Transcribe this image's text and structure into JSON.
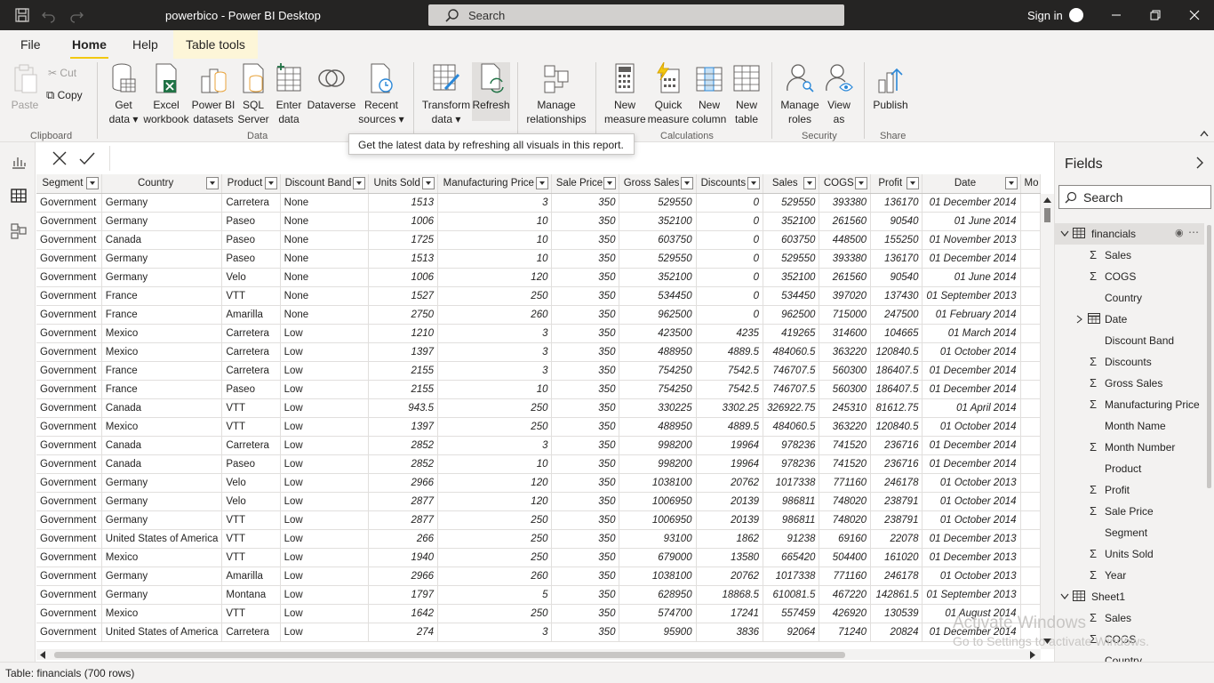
{
  "titlebar": {
    "title": "powerbico - Power BI Desktop",
    "search_placeholder": "Search",
    "sign_in": "Sign in"
  },
  "ribbon_tabs": [
    "File",
    "Home",
    "Help",
    "Table tools"
  ],
  "ribbon": {
    "clipboard": {
      "paste": "Paste",
      "cut": "Cut",
      "copy": "Copy",
      "label": "Clipboard"
    },
    "data": {
      "get_data": [
        "Get",
        "data"
      ],
      "excel": [
        "Excel",
        "workbook"
      ],
      "pbi_datasets": [
        "Power BI",
        "datasets"
      ],
      "sql": [
        "SQL",
        "Server"
      ],
      "enter_data": [
        "Enter",
        "data"
      ],
      "dataverse": [
        "Dataverse",
        ""
      ],
      "recent": [
        "Recent",
        "sources"
      ],
      "label": "Data"
    },
    "queries": {
      "transform": [
        "Transform",
        "data"
      ],
      "refresh": [
        "Refresh",
        ""
      ]
    },
    "relationships": {
      "manage": [
        "Manage",
        "relationships"
      ]
    },
    "calculations": {
      "new_measure": [
        "New",
        "measure"
      ],
      "quick_measure": [
        "Quick",
        "measure"
      ],
      "new_column": [
        "New",
        "column"
      ],
      "new_table": [
        "New",
        "table"
      ],
      "label": "Calculations"
    },
    "security": {
      "manage_roles": [
        "Manage",
        "roles"
      ],
      "view_as": [
        "View",
        "as"
      ],
      "label": "Security"
    },
    "share": {
      "publish": "Publish",
      "label": "Share"
    }
  },
  "tooltip": "Get the latest data by refreshing all visuals in this report.",
  "grid": {
    "columns": [
      "Segment",
      "Country",
      "Product",
      "Discount Band",
      "Units Sold",
      "Manufacturing Price",
      "Sale Price",
      "Gross Sales",
      "Discounts",
      "Sales",
      "COGS",
      "Profit",
      "Date",
      "Mo"
    ],
    "rows": [
      [
        "Government",
        "Germany",
        "Carretera",
        "None",
        "1513",
        "3",
        "350",
        "529550",
        "0",
        "529550",
        "393380",
        "136170",
        "01 December 2014"
      ],
      [
        "Government",
        "Germany",
        "Paseo",
        "None",
        "1006",
        "10",
        "350",
        "352100",
        "0",
        "352100",
        "261560",
        "90540",
        "01 June 2014"
      ],
      [
        "Government",
        "Canada",
        "Paseo",
        "None",
        "1725",
        "10",
        "350",
        "603750",
        "0",
        "603750",
        "448500",
        "155250",
        "01 November 2013"
      ],
      [
        "Government",
        "Germany",
        "Paseo",
        "None",
        "1513",
        "10",
        "350",
        "529550",
        "0",
        "529550",
        "393380",
        "136170",
        "01 December 2014"
      ],
      [
        "Government",
        "Germany",
        "Velo",
        "None",
        "1006",
        "120",
        "350",
        "352100",
        "0",
        "352100",
        "261560",
        "90540",
        "01 June 2014"
      ],
      [
        "Government",
        "France",
        "VTT",
        "None",
        "1527",
        "250",
        "350",
        "534450",
        "0",
        "534450",
        "397020",
        "137430",
        "01 September 2013"
      ],
      [
        "Government",
        "France",
        "Amarilla",
        "None",
        "2750",
        "260",
        "350",
        "962500",
        "0",
        "962500",
        "715000",
        "247500",
        "01 February 2014"
      ],
      [
        "Government",
        "Mexico",
        "Carretera",
        "Low",
        "1210",
        "3",
        "350",
        "423500",
        "4235",
        "419265",
        "314600",
        "104665",
        "01 March 2014"
      ],
      [
        "Government",
        "Mexico",
        "Carretera",
        "Low",
        "1397",
        "3",
        "350",
        "488950",
        "4889.5",
        "484060.5",
        "363220",
        "120840.5",
        "01 October 2014"
      ],
      [
        "Government",
        "France",
        "Carretera",
        "Low",
        "2155",
        "3",
        "350",
        "754250",
        "7542.5",
        "746707.5",
        "560300",
        "186407.5",
        "01 December 2014"
      ],
      [
        "Government",
        "France",
        "Paseo",
        "Low",
        "2155",
        "10",
        "350",
        "754250",
        "7542.5",
        "746707.5",
        "560300",
        "186407.5",
        "01 December 2014"
      ],
      [
        "Government",
        "Canada",
        "VTT",
        "Low",
        "943.5",
        "250",
        "350",
        "330225",
        "3302.25",
        "326922.75",
        "245310",
        "81612.75",
        "01 April 2014"
      ],
      [
        "Government",
        "Mexico",
        "VTT",
        "Low",
        "1397",
        "250",
        "350",
        "488950",
        "4889.5",
        "484060.5",
        "363220",
        "120840.5",
        "01 October 2014"
      ],
      [
        "Government",
        "Canada",
        "Carretera",
        "Low",
        "2852",
        "3",
        "350",
        "998200",
        "19964",
        "978236",
        "741520",
        "236716",
        "01 December 2014"
      ],
      [
        "Government",
        "Canada",
        "Paseo",
        "Low",
        "2852",
        "10",
        "350",
        "998200",
        "19964",
        "978236",
        "741520",
        "236716",
        "01 December 2014"
      ],
      [
        "Government",
        "Germany",
        "Velo",
        "Low",
        "2966",
        "120",
        "350",
        "1038100",
        "20762",
        "1017338",
        "771160",
        "246178",
        "01 October 2013"
      ],
      [
        "Government",
        "Germany",
        "Velo",
        "Low",
        "2877",
        "120",
        "350",
        "1006950",
        "20139",
        "986811",
        "748020",
        "238791",
        "01 October 2014"
      ],
      [
        "Government",
        "Germany",
        "VTT",
        "Low",
        "2877",
        "250",
        "350",
        "1006950",
        "20139",
        "986811",
        "748020",
        "238791",
        "01 October 2014"
      ],
      [
        "Government",
        "United States of America",
        "VTT",
        "Low",
        "266",
        "250",
        "350",
        "93100",
        "1862",
        "91238",
        "69160",
        "22078",
        "01 December 2013"
      ],
      [
        "Government",
        "Mexico",
        "VTT",
        "Low",
        "1940",
        "250",
        "350",
        "679000",
        "13580",
        "665420",
        "504400",
        "161020",
        "01 December 2013"
      ],
      [
        "Government",
        "Germany",
        "Amarilla",
        "Low",
        "2966",
        "260",
        "350",
        "1038100",
        "20762",
        "1017338",
        "771160",
        "246178",
        "01 October 2013"
      ],
      [
        "Government",
        "Germany",
        "Montana",
        "Low",
        "1797",
        "5",
        "350",
        "628950",
        "18868.5",
        "610081.5",
        "467220",
        "142861.5",
        "01 September 2013"
      ],
      [
        "Government",
        "Mexico",
        "VTT",
        "Low",
        "1642",
        "250",
        "350",
        "574700",
        "17241",
        "557459",
        "426920",
        "130539",
        "01 August 2014"
      ],
      [
        "Government",
        "United States of America",
        "Carretera",
        "Low",
        "274",
        "3",
        "350",
        "95900",
        "3836",
        "92064",
        "71240",
        "20824",
        "01 December 2014"
      ]
    ]
  },
  "statusbar": "Table: financials (700 rows)",
  "fields_pane": {
    "title": "Fields",
    "search_placeholder": "Search",
    "items": [
      {
        "kind": "table",
        "label": "financials"
      },
      {
        "kind": "sum",
        "label": "Sales"
      },
      {
        "kind": "sum",
        "label": "COGS"
      },
      {
        "kind": "text",
        "label": "Country"
      },
      {
        "kind": "date",
        "label": "Date"
      },
      {
        "kind": "text",
        "label": "Discount Band"
      },
      {
        "kind": "sum",
        "label": "Discounts"
      },
      {
        "kind": "sum",
        "label": "Gross Sales"
      },
      {
        "kind": "sum",
        "label": "Manufacturing Price"
      },
      {
        "kind": "text",
        "label": "Month Name"
      },
      {
        "kind": "sum",
        "label": "Month Number"
      },
      {
        "kind": "text",
        "label": "Product"
      },
      {
        "kind": "sum",
        "label": "Profit"
      },
      {
        "kind": "sum",
        "label": "Sale Price"
      },
      {
        "kind": "text",
        "label": "Segment"
      },
      {
        "kind": "sum",
        "label": "Units Sold"
      },
      {
        "kind": "sum",
        "label": "Year"
      },
      {
        "kind": "table",
        "label": "Sheet1"
      },
      {
        "kind": "sum",
        "label": "Sales"
      },
      {
        "kind": "sum",
        "label": "COGS"
      },
      {
        "kind": "text",
        "label": "Country"
      }
    ]
  },
  "watermark": {
    "line1": "Activate Windows",
    "line2": "Go to Settings to activate Windows."
  },
  "colors": {
    "accent": "#f2c811",
    "titlebar": "#252423",
    "ribbon_bg": "#f3f2f1"
  }
}
